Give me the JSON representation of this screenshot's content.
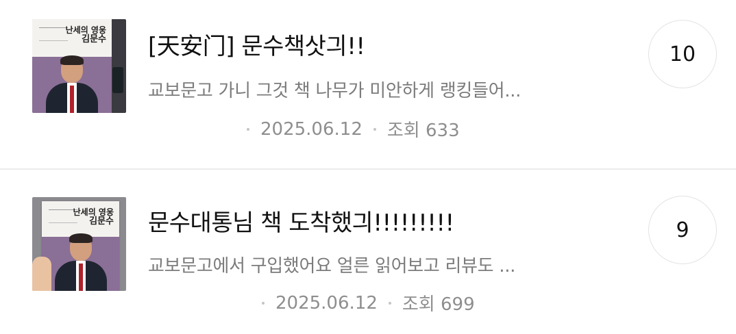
{
  "posts": [
    {
      "title": "[天安门] 문수책삿긔!!",
      "excerpt": "교보문고 가니 그것 책 나무가 미안하게 랭킹들어...",
      "author": "",
      "date": "2025.06.12",
      "views": "조회 633",
      "comment_count": "10",
      "thumbnail_book_title_line1": "난세의 영웅",
      "thumbnail_book_title_line2": "김문수"
    },
    {
      "title": "문수대통님 책 도착했긔!!!!!!!!!",
      "excerpt": "교보문고에서 구입했어요 얼른 읽어보고 리뷰도 ...",
      "author": "",
      "date": "2025.06.12",
      "views": "조회 699",
      "comment_count": "9",
      "thumbnail_book_title_line1": "난세의 영웅",
      "thumbnail_book_title_line2": "김문수"
    }
  ]
}
